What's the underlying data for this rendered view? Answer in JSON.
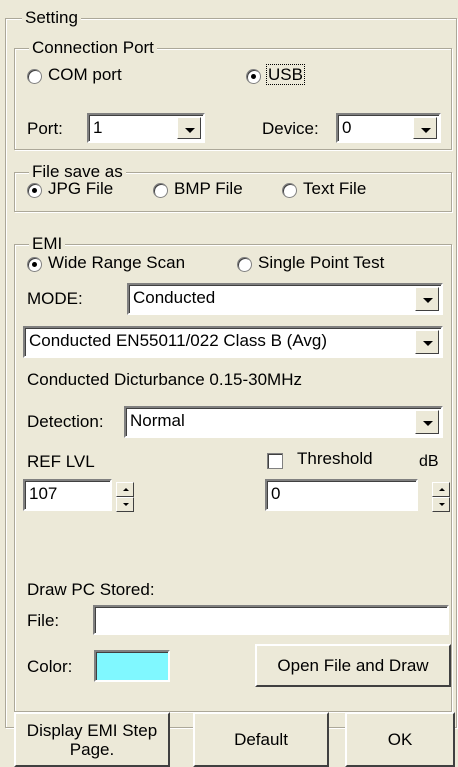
{
  "setting": {
    "title": "Setting",
    "connection": {
      "title": "Connection Port",
      "com_label": "COM port",
      "usb_label": "USB",
      "selected": "USB",
      "port_label": "Port:",
      "port_value": "1",
      "device_label": "Device:",
      "device_value": "0"
    },
    "file_save": {
      "title": "File save as",
      "options": [
        "JPG File",
        "BMP File",
        "Text File"
      ],
      "selected": "JPG File"
    },
    "emi": {
      "title": "EMI",
      "scan_options": [
        "Wide Range Scan",
        "Single Point Test"
      ],
      "selected": "Wide Range Scan",
      "mode_label": "MODE:",
      "mode_value": "Conducted",
      "standard_value": "Conducted EN55011/022 Class B (Avg)",
      "description": "Conducted Dicturbance 0.15-30MHz",
      "detection_label": "Detection:",
      "detection_value": "Normal",
      "ref_lvl_label": "REF LVL",
      "ref_lvl_value": "107",
      "threshold_label": "Threshold",
      "threshold_checked": false,
      "threshold_unit": "dB",
      "threshold_value": "0",
      "draw_label": "Draw PC Stored:",
      "file_label": "File:",
      "file_value": "",
      "color_label": "Color:",
      "color_value": "#80f8ff",
      "open_button": "Open File and Draw"
    }
  },
  "buttons": {
    "display_emi": "Display EMI Step Page.",
    "default": "Default",
    "ok": "OK"
  }
}
